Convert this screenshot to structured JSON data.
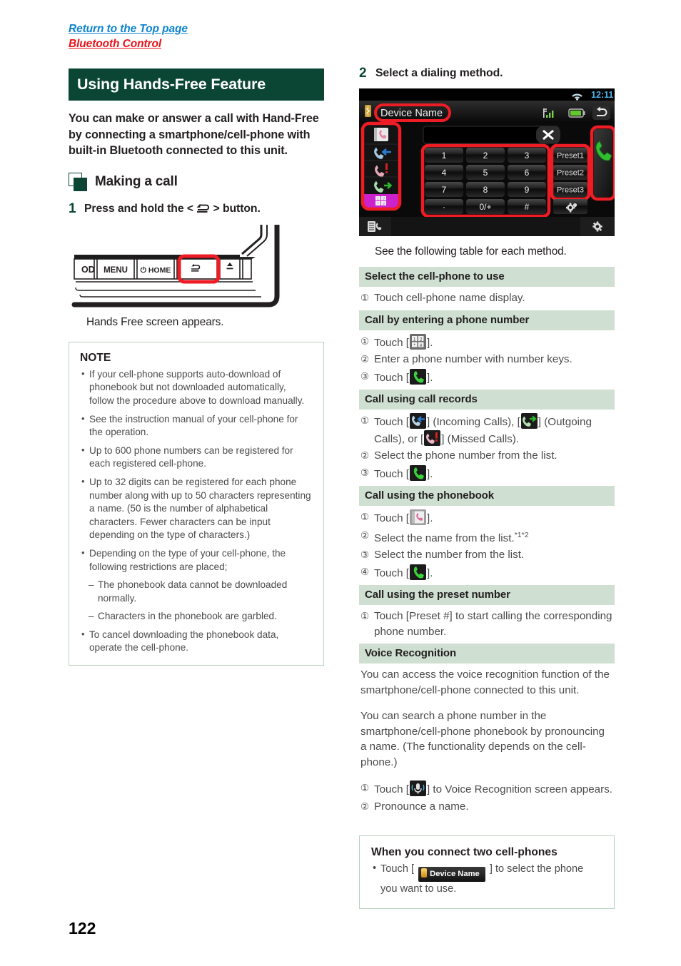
{
  "page": {
    "number": "122",
    "top_links": [
      {
        "label": "Return to the Top page",
        "color": "#0d84cf"
      },
      {
        "label": "Bluetooth Control",
        "color": "#e8141c"
      }
    ]
  },
  "section": {
    "title": "Using Hands-Free Feature",
    "banner_color": "#0b4634",
    "intro": "You can make or answer a call with Hand-Free by connecting a smartphone/cell-phone with built-in  Bluetooth connected to this unit.",
    "subheading": "Making a call"
  },
  "step1": {
    "number": "1",
    "text_before": "Press and hold the <",
    "glyph": "return-button-glyph",
    "text_after": "> button.",
    "caption": "Hands Free screen appears.",
    "faceplate": {
      "buttons": [
        "OD",
        "MENU",
        "HOME",
        "return",
        "eject"
      ],
      "menu_label": "MENU",
      "home_label": "HOME",
      "od_label": "OD",
      "highlight_color": "#ee1c25"
    }
  },
  "note": {
    "title": "NOTE",
    "items": [
      {
        "type": "bullet",
        "text": "If your cell-phone supports auto-download of phonebook but not downloaded automatically, follow the procedure above to download manually."
      },
      {
        "type": "bullet",
        "text": "See the instruction manual of your cell-phone for the operation."
      },
      {
        "type": "bullet",
        "text": "Up to 600 phone numbers can be registered for each registered cell-phone."
      },
      {
        "type": "bullet",
        "text": "Up to 32 digits can be registered for each phone number along with up to 50 characters representing a name. (50 is the number of alphabetical characters. Fewer characters can be input depending on the type of characters.)"
      },
      {
        "type": "bullet",
        "text": "Depending on the type of your cell-phone, the following restrictions are placed;"
      },
      {
        "type": "dash",
        "text": "The phonebook data cannot be downloaded normally."
      },
      {
        "type": "dash",
        "text": "Characters in the phonebook are garbled."
      },
      {
        "type": "bullet",
        "text": "To cancel downloading the phonebook data, operate the cell-phone."
      }
    ]
  },
  "step2": {
    "number": "2",
    "text": "Select a dialing method.",
    "caption": "See the following table for each method."
  },
  "device_screen": {
    "status_time": "12:11",
    "device_name": "Device Name",
    "wifi_icon": "wifi-icon",
    "signal_icon": "signal-bars-icon",
    "battery_icon": "battery-icon",
    "back_icon": "return-arrow-icon",
    "clear_icon": "clear-x-icon",
    "side_icons": [
      "phonebook-icon",
      "incoming-calls-icon",
      "missed-calls-icon",
      "outgoing-calls-icon",
      "keypad-icon"
    ],
    "keypad_keys": [
      "1",
      "2",
      "3",
      "4",
      "5",
      "6",
      "7",
      "8",
      "9",
      "*",
      "0/+",
      "#"
    ],
    "keypad_dot_label": "·",
    "presets": [
      "Preset1",
      "Preset2",
      "Preset3"
    ],
    "settings_icon": "gear-icon",
    "call_icon": "green-handset-icon",
    "bottom_left_icon": "phone-list-icon",
    "bottom_right_icon": "gear-icon",
    "highlight_color": "#ee1c25",
    "keypad_active_color": "#cc22cc"
  },
  "methods": [
    {
      "heading": "Select the cell-phone to use",
      "lines": [
        {
          "num": "①",
          "text": "Touch cell-phone name display."
        }
      ]
    },
    {
      "heading": "Call by entering a phone number",
      "lines": [
        {
          "num": "①",
          "text": "Touch [ ].",
          "icon": "keypad-icon"
        },
        {
          "num": "②",
          "text": "Enter a phone number with number keys."
        },
        {
          "num": "③",
          "text": "Touch [ ].",
          "icon": "call-icon"
        }
      ]
    },
    {
      "heading": "Call using call records",
      "lines": [
        {
          "num": "①",
          "text": "Touch [ ] (Incoming Calls), [ ] (Outgoing Calls), or [ ] (Missed Calls).",
          "icon": "incoming-outgoing-missed-icons"
        },
        {
          "num": "②",
          "text": "Select the phone number from the list."
        },
        {
          "num": "③",
          "text": "Touch [ ].",
          "icon": "call-icon"
        }
      ]
    },
    {
      "heading": "Call using the phonebook",
      "lines": [
        {
          "num": "①",
          "text": "Touch [ ].",
          "icon": "phonebook-icon"
        },
        {
          "num": "②",
          "text": "Select the name from the list.",
          "footnote": "*1*2"
        },
        {
          "num": "③",
          "text": "Select the number from the list."
        },
        {
          "num": "④",
          "text": "Touch [ ].",
          "icon": "call-icon"
        }
      ]
    },
    {
      "heading": "Call using the preset number",
      "lines": [
        {
          "num": "①",
          "text": "Touch [Preset #] to start calling the corresponding phone number."
        }
      ]
    },
    {
      "heading": "Voice Recognition",
      "paragraphs": [
        "You can access the voice recognition function of the smartphone/cell-phone connected to this unit.",
        "You can search a phone number in the smartphone/cell-phone phonebook by pronouncing a name. (The functionality depends on the cell-phone.)"
      ],
      "lines": [
        {
          "num": "①",
          "text": "Touch [ ] to Voice Recognition screen appears.",
          "icon": "voice-recognition-icon"
        },
        {
          "num": "②",
          "text": "Pronounce a name."
        }
      ]
    }
  ],
  "tip": {
    "title": "When you connect two cell-phones",
    "bullet_before": "Touch [",
    "chip_label": "Device Name",
    "bullet_after": "] to select the phone you want to use."
  }
}
